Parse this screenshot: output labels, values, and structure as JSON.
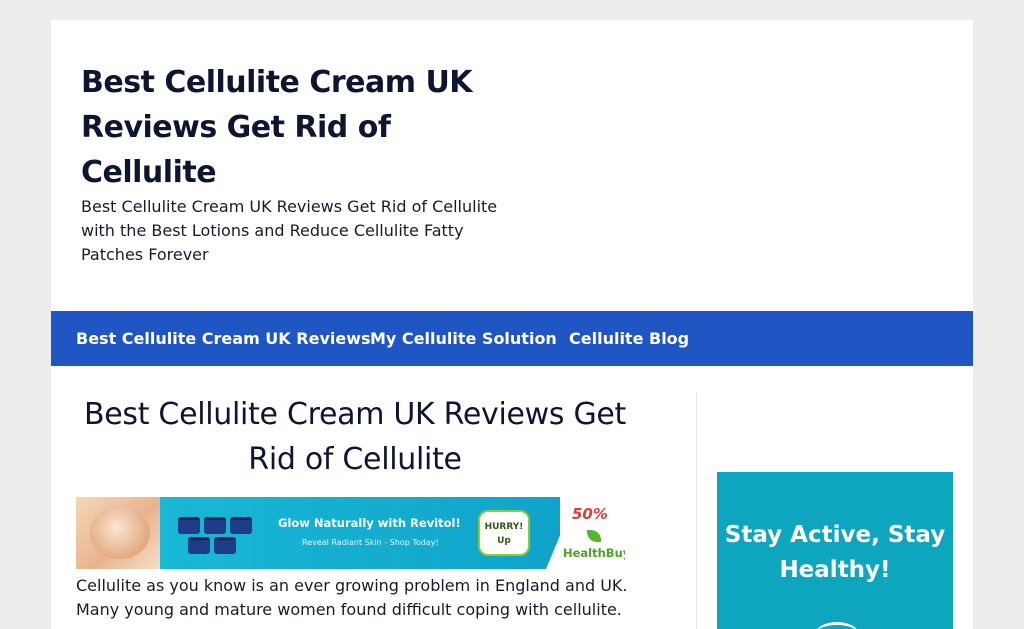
{
  "header": {
    "site_title": "Best Cellulite Cream UK Reviews Get Rid of Cellulite",
    "site_description": "Best Cellulite Cream UK Reviews Get Rid of Cellulite with the Best Lotions and Reduce Cellulite Fatty Patches Forever"
  },
  "nav": {
    "items": [
      {
        "label": "Best Cellulite Cream UK Reviews"
      },
      {
        "label": "My Cellulite Solution"
      },
      {
        "label": "Cellulite Blog"
      }
    ]
  },
  "post": {
    "title": "Best Cellulite Cream UK Reviews Get Rid of Cellulite",
    "excerpt": "Cellulite as you know is an ever growing problem in England and UK. Many young and mature women found difficult coping with cellulite."
  },
  "banner": {
    "headline": "Glow Naturally with Revitol!",
    "subline": "Reveal Radiant Skin - Shop Today!",
    "badge": "HURRY! Up",
    "discount": "50%",
    "brand": "HealthBuy"
  },
  "sidebar_ad": {
    "text": "Stay Active, Stay Healthy!"
  },
  "colors": {
    "nav_background": "#1f56c3",
    "ad_background": "#0ea5bf",
    "page_background": "#ececec"
  }
}
